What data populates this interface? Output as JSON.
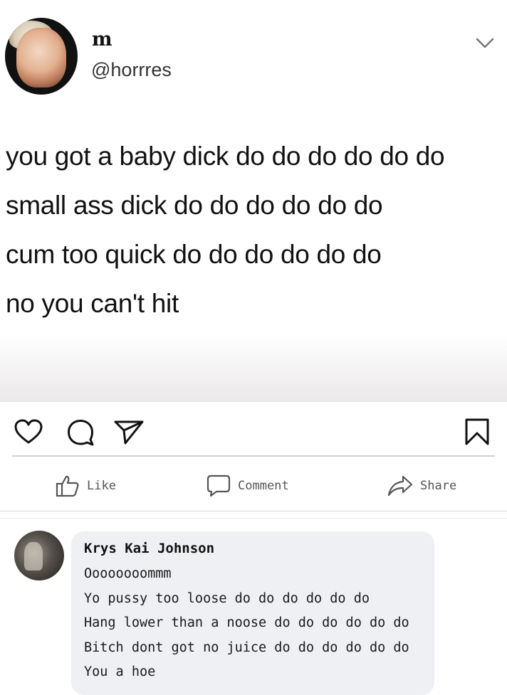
{
  "tweet": {
    "display_name": "m",
    "handle": "@horrres",
    "lines": [
      "you got a baby dick do do do do do do",
      "small ass dick do do do do do do",
      "cum too quick do do do do do do",
      "no you can't hit"
    ]
  },
  "instagram_actions": {
    "icons": [
      "heart-icon",
      "comment-bubble-icon",
      "send-icon",
      "bookmark-icon"
    ]
  },
  "facebook_actions": {
    "like": "Like",
    "comment": "Comment",
    "share": "Share"
  },
  "comment": {
    "author": "Krys Kai Johnson",
    "lines": [
      "Oooooooommm",
      "Yo pussy too loose do do do do do do",
      "Hang lower than a noose do do do do do do",
      "Bitch dont got no juice do do do do do do",
      "You a hoe"
    ]
  },
  "colors": {
    "text": "#111111",
    "icon_gray": "#555555",
    "bubble_bg": "#eef0f3"
  }
}
